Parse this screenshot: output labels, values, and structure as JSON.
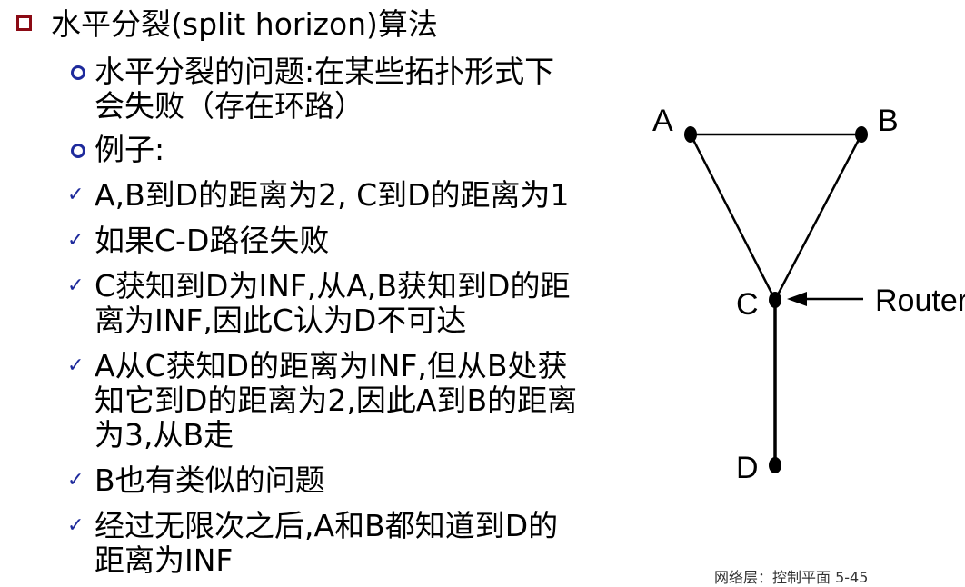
{
  "heading": "水平分裂(split horizon)算法",
  "sub_items": [
    {
      "lines": [
        "水平分裂的问题:在某些拓扑形式下",
        "会失败（存在环路）"
      ]
    },
    {
      "lines": [
        "例子:"
      ]
    }
  ],
  "check_items": [
    {
      "lines": [
        "A,B到D的距离为2, C到D的距离为1"
      ]
    },
    {
      "lines": [
        "如果C-D路径失败"
      ]
    },
    {
      "lines": [
        "C获知到D为INF,从A,B获知到D的距",
        "离为INF,因此C认为D不可达"
      ]
    },
    {
      "lines": [
        "A从C获知D的距离为INF,但从B处获",
        "知它到D的距离为2,因此A到B的距离",
        "为3,从B走"
      ]
    },
    {
      "lines": [
        "B也有类似的问题"
      ]
    },
    {
      "lines": [
        "经过无限次之后,A和B都知道到D的",
        "距离为INF"
      ]
    }
  ],
  "diagram": {
    "nodes": {
      "a": "A",
      "b": "B",
      "c": "C",
      "d": "D"
    },
    "router_label": "Router"
  },
  "footer": "网络层：控制平面  5-45",
  "colors": {
    "square_bullet": "#8b0a14",
    "circle_bullet": "#1e2a9c",
    "check": "#1e2a9c"
  }
}
